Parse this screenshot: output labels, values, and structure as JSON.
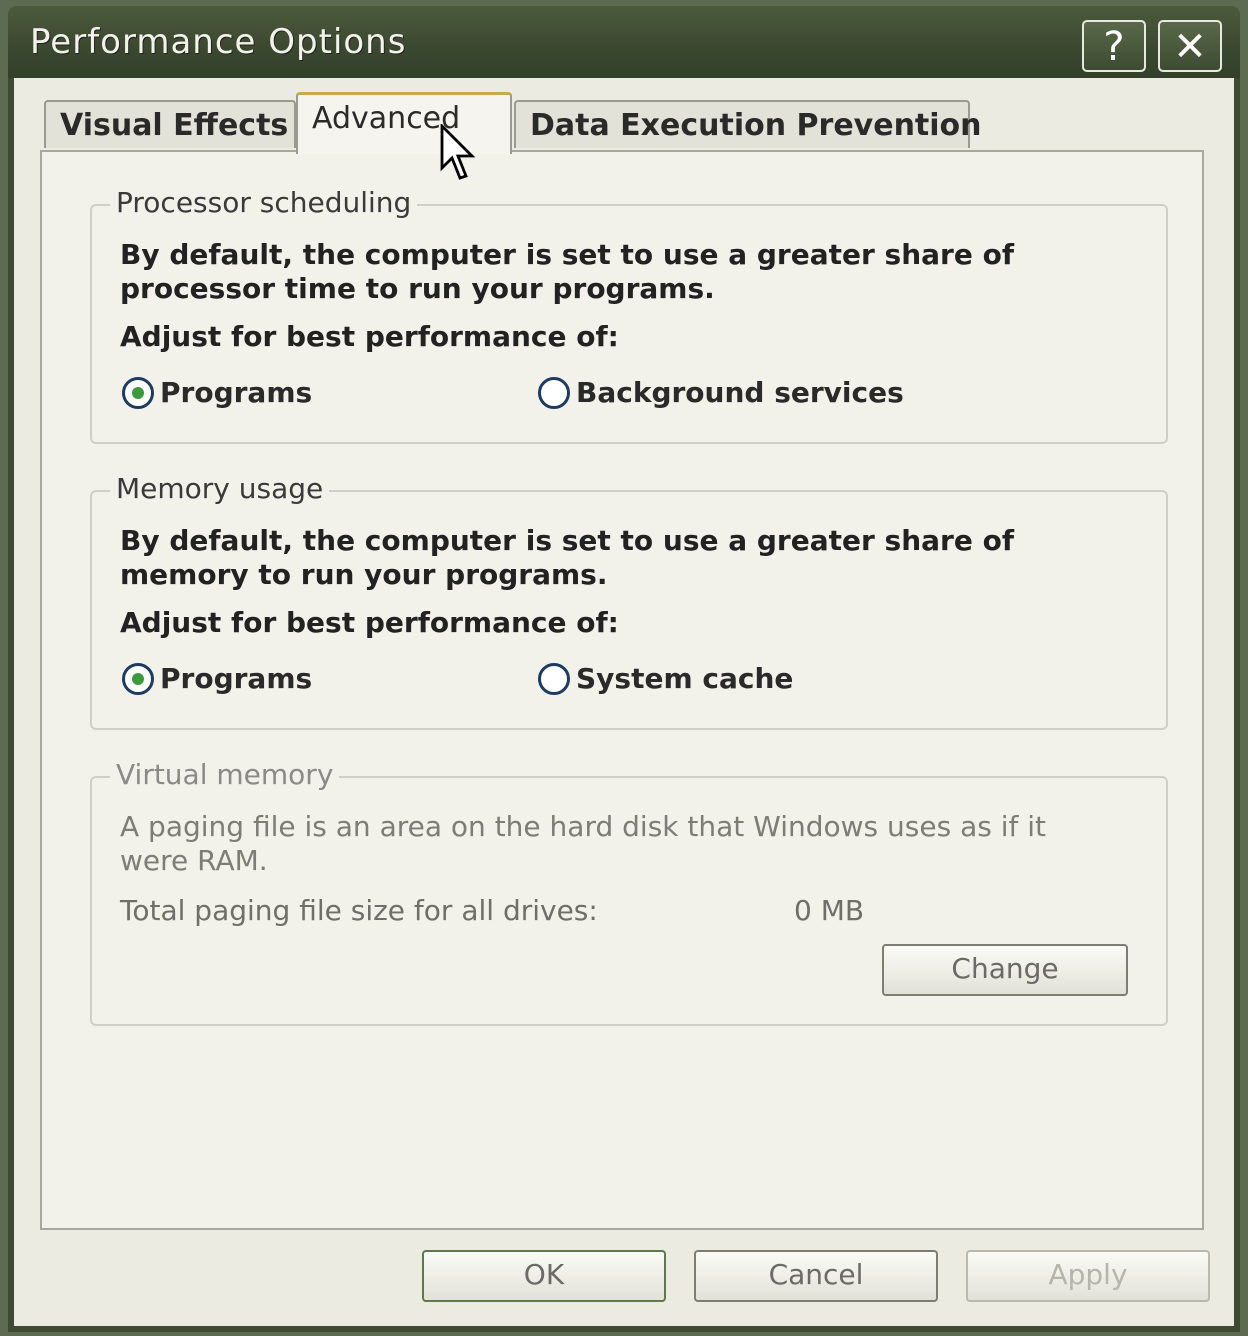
{
  "window": {
    "title": "Performance Options",
    "help_label": "?",
    "close_label": "✕"
  },
  "tabs": [
    {
      "label": "Visual Effects"
    },
    {
      "label": "Advanced",
      "active": true
    },
    {
      "label": "Data Execution Prevention"
    }
  ],
  "processor": {
    "legend": "Processor scheduling",
    "description": "By default, the computer is set to use a greater share of processor time to run your programs.",
    "adjust_label": "Adjust for best performance of:",
    "options": [
      {
        "label": "Programs",
        "selected": true
      },
      {
        "label": "Background services",
        "selected": false
      }
    ]
  },
  "memory": {
    "legend": "Memory usage",
    "description": "By default, the computer is set to use a greater share of memory to run your programs.",
    "adjust_label": "Adjust for best performance of:",
    "options": [
      {
        "label": "Programs",
        "selected": true
      },
      {
        "label": "System cache",
        "selected": false
      }
    ]
  },
  "virtual_memory": {
    "legend": "Virtual memory",
    "description": "A paging file is an area on the hard disk that Windows uses as if it were RAM.",
    "paging_label": "Total paging file size for all drives:",
    "paging_value": "0 MB",
    "change_label": "Change"
  },
  "footer": {
    "ok_label": "OK",
    "cancel_label": "Cancel",
    "apply_label": "Apply"
  }
}
